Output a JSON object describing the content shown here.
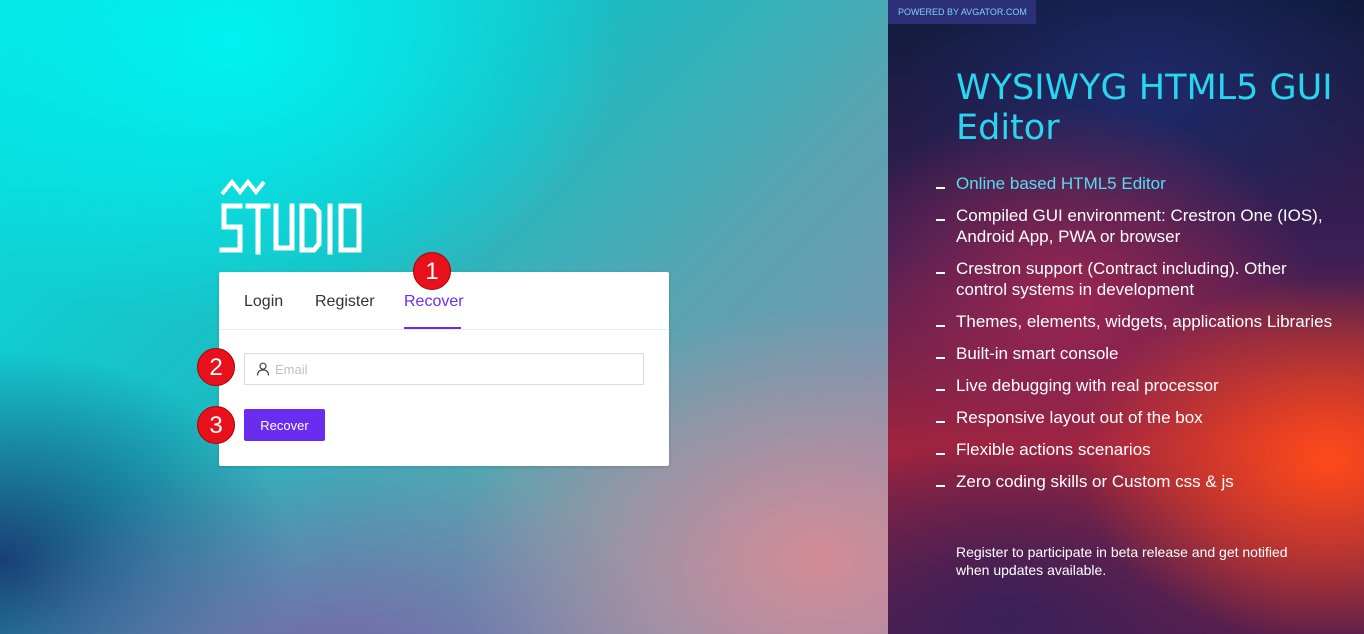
{
  "left": {
    "logo": {
      "mark": "AV",
      "text": "STUDIO"
    },
    "tabs": [
      {
        "label": "Login",
        "active": false
      },
      {
        "label": "Register",
        "active": false
      },
      {
        "label": "Recover",
        "active": true
      }
    ],
    "email": {
      "placeholder": "Email",
      "value": ""
    },
    "button": {
      "label": "Recover"
    },
    "markers": [
      "1",
      "2",
      "3"
    ],
    "colors": {
      "accent": "#6a2df0",
      "marker": "#e8101a"
    }
  },
  "right": {
    "powered": "POWERED BY AVGATOR.COM",
    "headline": "WYSIWYG HTML5 GUI Editor",
    "features": [
      "Online based HTML5 Editor",
      "Compiled GUI environment: Crestron One (IOS), Android App, PWA or browser",
      "Crestron support (Contract including). Other control systems in development",
      "Themes, elements, widgets, applications Libraries",
      "Built-in smart console",
      "Live debugging with real processor",
      "Responsive layout out of the box",
      "Flexible actions scenarios",
      "Zero coding skills or Custom css & js"
    ],
    "note": "Register to participate in beta release and get notified when updates available.",
    "colors": {
      "headline": "#29d6f0",
      "first_feature": "#58dcf0"
    }
  },
  "icons": {
    "email_field": "user-icon"
  }
}
